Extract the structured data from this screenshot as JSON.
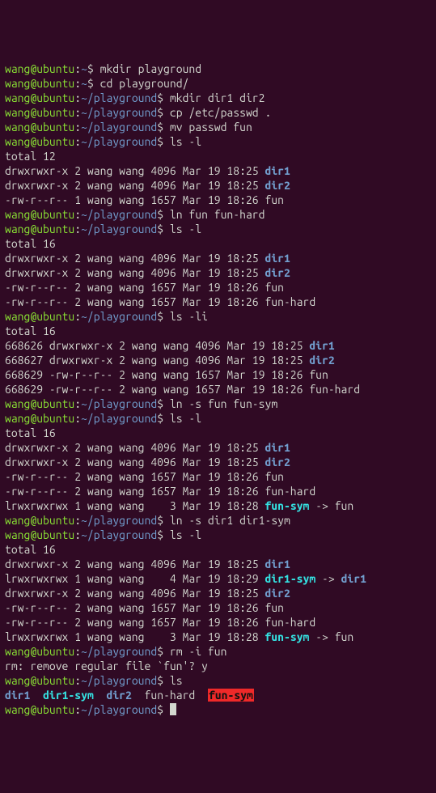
{
  "prompt": {
    "user": "wang",
    "host": "ubuntu",
    "home_path": "~",
    "work_path": "~/playground"
  },
  "colors": {
    "bg": "#300a24",
    "fg": "#d3d7cf",
    "user": "#8ae234",
    "path": "#729fcf",
    "dir": "#729fcf",
    "symlink": "#34e2e2",
    "broken_bg": "#ef2929"
  },
  "lines": [
    {
      "type": "cmd",
      "cwd": "~",
      "text": "mkdir playground"
    },
    {
      "type": "cmd",
      "cwd": "~",
      "text": "cd playground/"
    },
    {
      "type": "cmd",
      "cwd": "~/playground",
      "text": "mkdir dir1 dir2"
    },
    {
      "type": "cmd",
      "cwd": "~/playground",
      "text": "cp /etc/passwd ."
    },
    {
      "type": "cmd",
      "cwd": "~/playground",
      "text": "mv passwd fun"
    },
    {
      "type": "cmd",
      "cwd": "~/playground",
      "text": "ls -l"
    },
    {
      "type": "out",
      "segments": [
        {
          "t": "total 12"
        }
      ]
    },
    {
      "type": "out",
      "segments": [
        {
          "t": "drwxrwxr-x 2 wang wang 4096 Mar 19 18:25 "
        },
        {
          "t": "dir1",
          "c": "dir"
        }
      ]
    },
    {
      "type": "out",
      "segments": [
        {
          "t": "drwxrwxr-x 2 wang wang 4096 Mar 19 18:25 "
        },
        {
          "t": "dir2",
          "c": "dir"
        }
      ]
    },
    {
      "type": "out",
      "segments": [
        {
          "t": "-rw-r--r-- 1 wang wang 1657 Mar 19 18:26 fun"
        }
      ]
    },
    {
      "type": "cmd",
      "cwd": "~/playground",
      "text": "ln fun fun-hard"
    },
    {
      "type": "cmd",
      "cwd": "~/playground",
      "text": "ls -l"
    },
    {
      "type": "out",
      "segments": [
        {
          "t": "total 16"
        }
      ]
    },
    {
      "type": "out",
      "segments": [
        {
          "t": "drwxrwxr-x 2 wang wang 4096 Mar 19 18:25 "
        },
        {
          "t": "dir1",
          "c": "dir"
        }
      ]
    },
    {
      "type": "out",
      "segments": [
        {
          "t": "drwxrwxr-x 2 wang wang 4096 Mar 19 18:25 "
        },
        {
          "t": "dir2",
          "c": "dir"
        }
      ]
    },
    {
      "type": "out",
      "segments": [
        {
          "t": "-rw-r--r-- 2 wang wang 1657 Mar 19 18:26 fun"
        }
      ]
    },
    {
      "type": "out",
      "segments": [
        {
          "t": "-rw-r--r-- 2 wang wang 1657 Mar 19 18:26 fun-hard"
        }
      ]
    },
    {
      "type": "cmd",
      "cwd": "~/playground",
      "text": "ls -li"
    },
    {
      "type": "out",
      "segments": [
        {
          "t": "total 16"
        }
      ]
    },
    {
      "type": "out",
      "segments": [
        {
          "t": "668626 drwxrwxr-x 2 wang wang 4096 Mar 19 18:25 "
        },
        {
          "t": "dir1",
          "c": "dir"
        }
      ]
    },
    {
      "type": "out",
      "segments": [
        {
          "t": "668627 drwxrwxr-x 2 wang wang 4096 Mar 19 18:25 "
        },
        {
          "t": "dir2",
          "c": "dir"
        }
      ]
    },
    {
      "type": "out",
      "segments": [
        {
          "t": "668629 -rw-r--r-- 2 wang wang 1657 Mar 19 18:26 fun"
        }
      ]
    },
    {
      "type": "out",
      "segments": [
        {
          "t": "668629 -rw-r--r-- 2 wang wang 1657 Mar 19 18:26 fun-hard"
        }
      ]
    },
    {
      "type": "cmd",
      "cwd": "~/playground",
      "text": "ln -s fun fun-sym"
    },
    {
      "type": "cmd",
      "cwd": "~/playground",
      "text": "ls -l"
    },
    {
      "type": "out",
      "segments": [
        {
          "t": "total 16"
        }
      ]
    },
    {
      "type": "out",
      "segments": [
        {
          "t": "drwxrwxr-x 2 wang wang 4096 Mar 19 18:25 "
        },
        {
          "t": "dir1",
          "c": "dir"
        }
      ]
    },
    {
      "type": "out",
      "segments": [
        {
          "t": "drwxrwxr-x 2 wang wang 4096 Mar 19 18:25 "
        },
        {
          "t": "dir2",
          "c": "dir"
        }
      ]
    },
    {
      "type": "out",
      "segments": [
        {
          "t": "-rw-r--r-- 2 wang wang 1657 Mar 19 18:26 fun"
        }
      ]
    },
    {
      "type": "out",
      "segments": [
        {
          "t": "-rw-r--r-- 2 wang wang 1657 Mar 19 18:26 fun-hard"
        }
      ]
    },
    {
      "type": "out",
      "segments": [
        {
          "t": "lrwxrwxrwx 1 wang wang    3 Mar 19 18:28 "
        },
        {
          "t": "fun-sym",
          "c": "sym"
        },
        {
          "t": " -> fun"
        }
      ]
    },
    {
      "type": "cmd",
      "cwd": "~/playground",
      "text": "ln -s dir1 dir1-sym"
    },
    {
      "type": "cmd",
      "cwd": "~/playground",
      "text": "ls -l"
    },
    {
      "type": "out",
      "segments": [
        {
          "t": "total 16"
        }
      ]
    },
    {
      "type": "out",
      "segments": [
        {
          "t": "drwxrwxr-x 2 wang wang 4096 Mar 19 18:25 "
        },
        {
          "t": "dir1",
          "c": "dir"
        }
      ]
    },
    {
      "type": "out",
      "segments": [
        {
          "t": "lrwxrwxrwx 1 wang wang    4 Mar 19 18:29 "
        },
        {
          "t": "dir1-sym",
          "c": "sym"
        },
        {
          "t": " -> "
        },
        {
          "t": "dir1",
          "c": "dir"
        }
      ]
    },
    {
      "type": "out",
      "segments": [
        {
          "t": "drwxrwxr-x 2 wang wang 4096 Mar 19 18:25 "
        },
        {
          "t": "dir2",
          "c": "dir"
        }
      ]
    },
    {
      "type": "out",
      "segments": [
        {
          "t": "-rw-r--r-- 2 wang wang 1657 Mar 19 18:26 fun"
        }
      ]
    },
    {
      "type": "out",
      "segments": [
        {
          "t": "-rw-r--r-- 2 wang wang 1657 Mar 19 18:26 fun-hard"
        }
      ]
    },
    {
      "type": "out",
      "segments": [
        {
          "t": "lrwxrwxrwx 1 wang wang    3 Mar 19 18:28 "
        },
        {
          "t": "fun-sym",
          "c": "sym"
        },
        {
          "t": " -> fun"
        }
      ]
    },
    {
      "type": "cmd",
      "cwd": "~/playground",
      "text": "rm -i fun"
    },
    {
      "type": "out",
      "segments": [
        {
          "t": "rm: remove regular file `fun'? y"
        }
      ]
    },
    {
      "type": "cmd",
      "cwd": "~/playground",
      "text": "ls"
    },
    {
      "type": "out",
      "segments": [
        {
          "t": "dir1",
          "c": "dir"
        },
        {
          "t": "  "
        },
        {
          "t": "dir1-sym",
          "c": "sym"
        },
        {
          "t": "  "
        },
        {
          "t": "dir2",
          "c": "dir"
        },
        {
          "t": "  "
        },
        {
          "t": "fun-hard"
        },
        {
          "t": "  "
        },
        {
          "t": "fun-sym",
          "c": "broken"
        }
      ]
    },
    {
      "type": "cmd",
      "cwd": "~/playground",
      "text": "",
      "cursor": true
    }
  ]
}
